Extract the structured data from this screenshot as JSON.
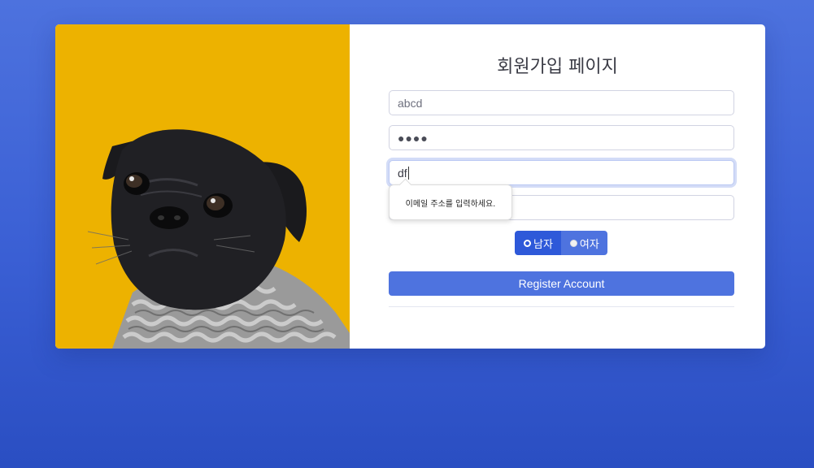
{
  "page": {
    "title": "회원가입 페이지"
  },
  "form": {
    "username_value": "abcd",
    "password_mask": "●●●●",
    "email_value": "df",
    "validation_tooltip": "이메일 주소를 입력하세요.",
    "gender_options": [
      {
        "label": "남자",
        "checked": true
      },
      {
        "label": "여자",
        "checked": false
      }
    ],
    "register_label": "Register Account"
  },
  "image": {
    "icon": "pug-photo",
    "background_color": "#edb200"
  },
  "colors": {
    "primary": "#4e73df",
    "primary_dark": "#2e59d9",
    "background": "#4d72de"
  }
}
